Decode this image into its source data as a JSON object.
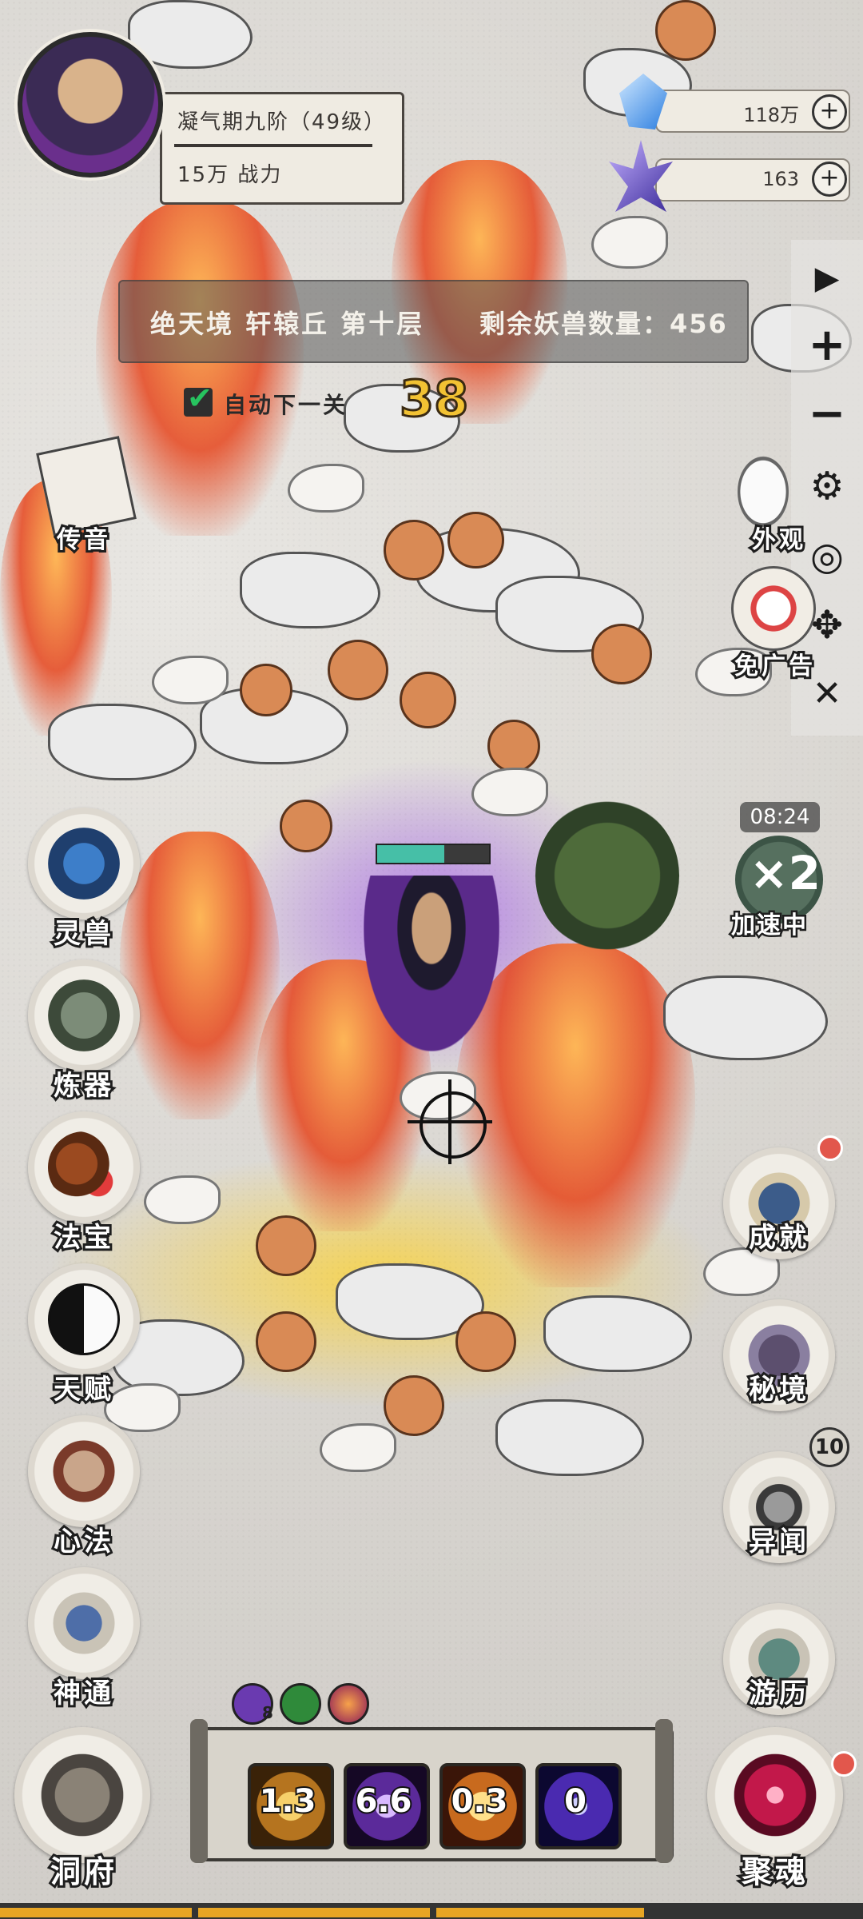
{
  "player": {
    "realm": "凝气期九阶（49级）",
    "power": "15万 战力"
  },
  "resources": [
    {
      "value": "118万",
      "icon": "blue-crystal-icon"
    },
    {
      "value": "163",
      "icon": "purple-crystal-icon"
    }
  ],
  "stage": {
    "location": "绝天境 轩辕丘 第十层",
    "remaining": "剩余妖兽数量：456",
    "auto_next_label": "自动下一关",
    "auto_next_checked": true,
    "countdown": "38"
  },
  "left_menu": [
    {
      "key": "chuanyin",
      "label": "传音",
      "icon": "message-scroll-icon"
    },
    {
      "key": "lingshou",
      "label": "灵兽",
      "icon": "spirit-beast-icon"
    },
    {
      "key": "lianqi",
      "label": "炼器",
      "icon": "cauldron-icon"
    },
    {
      "key": "fabao",
      "label": "法宝",
      "icon": "gourd-icon"
    },
    {
      "key": "tianfu",
      "label": "天赋",
      "icon": "yin-yang-icon"
    },
    {
      "key": "xinfa",
      "label": "心法",
      "icon": "scroll-icon"
    },
    {
      "key": "shentong",
      "label": "神通",
      "icon": "sword-book-icon"
    },
    {
      "key": "dongfu",
      "label": "洞府",
      "icon": "palace-icon"
    }
  ],
  "right_menu": [
    {
      "key": "waiguan",
      "label": "外观",
      "icon": "character-skin-icon"
    },
    {
      "key": "mianguanggao",
      "label": "免广告",
      "icon": "no-ads-icon"
    },
    {
      "key": "chengjiu",
      "label": "成就",
      "icon": "achievement-book-icon",
      "badge": "dot"
    },
    {
      "key": "mijing",
      "label": "秘境",
      "icon": "secret-realm-icon"
    },
    {
      "key": "yiwen",
      "label": "异闻",
      "icon": "sword-ring-icon",
      "badge": "10"
    },
    {
      "key": "youli",
      "label": "游历",
      "icon": "mountain-travel-icon"
    },
    {
      "key": "juhun",
      "label": "聚魂",
      "icon": "soul-vortex-icon",
      "badge": "dot"
    }
  ],
  "speed": {
    "timer": "08:24",
    "multiplier": "×2",
    "status": "加速中"
  },
  "toolbar": [
    "play-icon",
    "zoom-in-icon",
    "zoom-out-icon",
    "settings-icon",
    "hide-icon",
    "move-icon",
    "close-icon"
  ],
  "toolbar_glyphs": {
    "play": "▶",
    "plus": "+",
    "minus": "−",
    "gear": "⚙",
    "eye": "◎",
    "move": "✥",
    "close": "✕"
  },
  "buffs": [
    {
      "icon": "purple-dice-buff-icon",
      "count": "8"
    },
    {
      "icon": "green-buff-icon"
    },
    {
      "icon": "fire-orb-buff-icon"
    }
  ],
  "skills": [
    {
      "value": "1.3",
      "color": "#b5741f"
    },
    {
      "value": "6.6",
      "color": "#5b2a9a"
    },
    {
      "value": "0.3",
      "color": "#c86a1e"
    },
    {
      "value": "0",
      "color": "#4a2ab0"
    }
  ],
  "hero": {
    "hp_fraction": 0.6
  }
}
